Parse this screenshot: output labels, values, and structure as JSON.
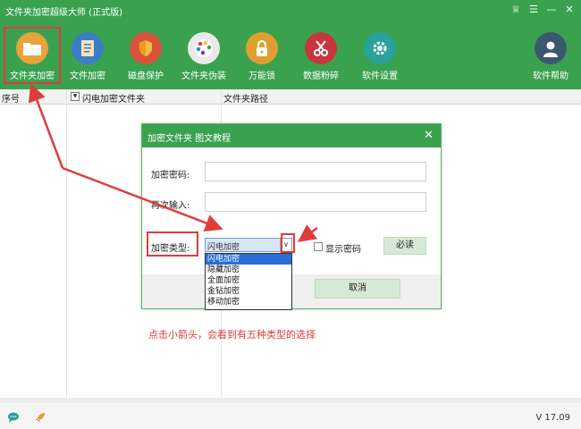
{
  "app": {
    "title": "文件夹加密超级大师 (正式版)",
    "version": "V 17.09"
  },
  "window_controls": [
    {
      "icon": "shirt-icon",
      "glyph": "♕"
    },
    {
      "icon": "menu-icon",
      "glyph": "☰"
    },
    {
      "icon": "minimize-icon",
      "glyph": "—"
    },
    {
      "icon": "close-icon",
      "glyph": "✕"
    }
  ],
  "toolbar": [
    {
      "label": "文件夹加密",
      "icon": "folder-icon",
      "color": "#e8a33a"
    },
    {
      "label": "文件加密",
      "icon": "document-icon",
      "color": "#3b7ec6"
    },
    {
      "label": "磁盘保护",
      "icon": "shield-icon",
      "color": "#d9533c"
    },
    {
      "label": "文件夹伪装",
      "icon": "palette-icon",
      "color": "#e9e9e9"
    },
    {
      "label": "万能锁",
      "icon": "lock-icon",
      "color": "#e0a030"
    },
    {
      "label": "数据粉碎",
      "icon": "scissors-icon",
      "color": "#c8363d"
    },
    {
      "label": "软件设置",
      "icon": "gear-icon",
      "color": "#2aa19a"
    },
    {
      "label": "软件帮助",
      "icon": "user-icon",
      "color": "#3b5870"
    }
  ],
  "table": {
    "col_number": "序号",
    "col_name": "闪电加密文件夹",
    "col_path": "文件夹路径"
  },
  "dialog": {
    "title": "加密文件夹 图文教程",
    "password_label": "加密密码:",
    "confirm_label": "再次输入:",
    "type_label": "加密类型:",
    "selected_type": "闪电加密",
    "type_options": [
      "闪电加密",
      "隐藏加密",
      "全面加密",
      "金钻加密",
      "移动加密"
    ],
    "show_password": "显示密码",
    "read_button": "必读",
    "cancel_button": "取消"
  },
  "note": "点击小箭头，会看到有五种类型的选择",
  "colors": {
    "header_green": "#3aa24f",
    "highlight_red": "#e03c3c",
    "selected_blue": "#2b6fd6"
  }
}
